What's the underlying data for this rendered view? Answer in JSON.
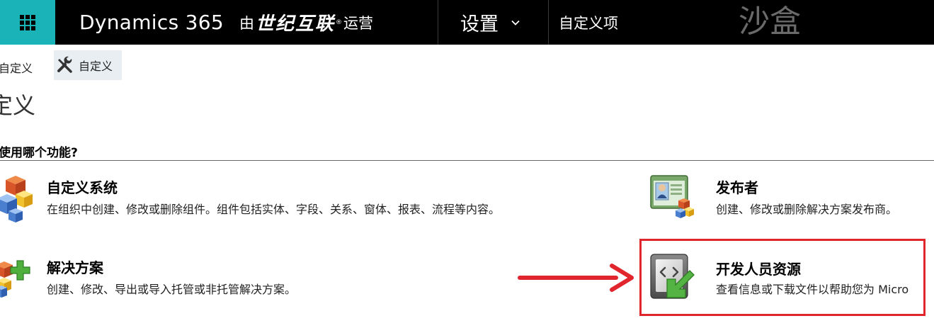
{
  "header": {
    "app_name": "Dynamics 365",
    "by_text": "由",
    "operator": "世纪互联",
    "registered": "®",
    "operated_text": "运营",
    "settings_label": "设置",
    "breadcrumb": "自定义项",
    "environment": "沙盒",
    "icons": {
      "app_launcher": "waffle-grid-icon",
      "dropdown": "chevron-down-icon"
    }
  },
  "toolbar": {
    "items": [
      {
        "label": "自定义"
      },
      {
        "label": "自定义",
        "icon": "wrench-screwdriver-icon"
      }
    ]
  },
  "page": {
    "title": "定义",
    "section_header": "使用哪个功能?"
  },
  "items": {
    "customize_system": {
      "title": "自定义系统",
      "description": "在组织中创建、修改或删除组件。组件包括实体、字段、关系、窗体、报表、流程等内容。",
      "icon": "cubes-icon"
    },
    "solutions": {
      "title": "解决方案",
      "description": "创建、修改、导出或导入托管或非托管解决方案。",
      "icon": "cubes-plus-icon"
    },
    "publishers": {
      "title": "发布者",
      "description": "创建、修改或删除解决方案发布商。",
      "icon": "publisher-icon"
    },
    "developer_resources": {
      "title": "开发人员资源",
      "description": "查看信息或下载文件以帮助您为 Micro",
      "icon": "developer-download-icon"
    }
  },
  "colors": {
    "topbar": "#000000",
    "launcher": "#1ab3b8",
    "toolbar_active": "#e9eef2",
    "annotation": "#e1252d"
  }
}
